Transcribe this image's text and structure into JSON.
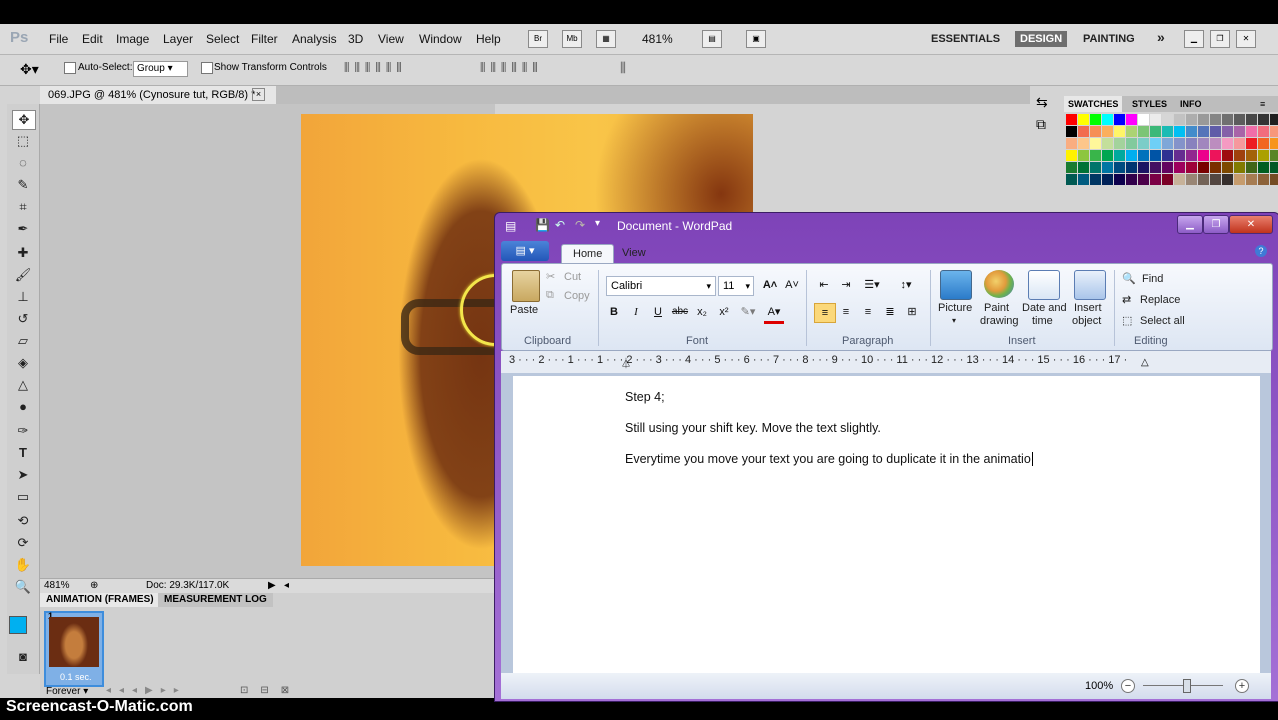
{
  "photoshop": {
    "logo": "Ps",
    "menu": [
      "File",
      "Edit",
      "Image",
      "Layer",
      "Select",
      "Filter",
      "Analysis",
      "3D",
      "View",
      "Window",
      "Help"
    ],
    "appbar": {
      "zoom": "481%",
      "br": "Br",
      "mb": "Mb"
    },
    "workspaces": [
      "ESSENTIALS",
      "DESIGN",
      "PAINTING"
    ],
    "workspace_more": "»",
    "options": {
      "auto_select_label": "Auto-Select:",
      "auto_select_value": "Group",
      "transform_label": "Show Transform Controls"
    },
    "doc_tab": {
      "title": "069.JPG @ 481% (Cynosure tut, RGB/8) *",
      "close": "×"
    },
    "status": {
      "zoom": "481%",
      "doc": "Doc: 29.3K/117.0K"
    },
    "anim_tabs": [
      "ANIMATION (FRAMES)",
      "MEASUREMENT LOG"
    ],
    "frame": {
      "number": "1",
      "delay": "0.1 sec."
    },
    "loop": "Forever",
    "swatch_tabs": [
      "SWATCHES",
      "STYLES",
      "INFO"
    ],
    "swatch_colors": [
      "#ff0000",
      "#ffff00",
      "#00ff00",
      "#00ffff",
      "#0000ff",
      "#ff00ff",
      "#ffffff",
      "#ebebeb",
      "#d6d6d6",
      "#c2c2c2",
      "#adadad",
      "#999999",
      "#858585",
      "#707070",
      "#5c5c5c",
      "#474747",
      "#333333",
      "#1f1f1f",
      "#000000",
      "#f26c4f",
      "#f68e56",
      "#fbaf5d",
      "#fff568",
      "#acd373",
      "#7cc576",
      "#3bb878",
      "#1abbb4",
      "#00bff3",
      "#438ccb",
      "#5574b9",
      "#605ca8",
      "#8560a8",
      "#a864a8",
      "#f06ea9",
      "#f26d7d",
      "#f7977a",
      "#f9ad81",
      "#fdc68a",
      "#fff79a",
      "#c4df9b",
      "#a3d39c",
      "#82ca9d",
      "#7bcdc8",
      "#6ecff6",
      "#7ea7d8",
      "#8493ca",
      "#8882be",
      "#a187be",
      "#bc8dbf",
      "#f49ac2",
      "#f6989d",
      "#ed1c24",
      "#f26522",
      "#f7941d",
      "#fff200",
      "#8dc63f",
      "#39b54a",
      "#00a651",
      "#00a99d",
      "#00aeef",
      "#0072bc",
      "#0054a6",
      "#2e3192",
      "#662d91",
      "#92278f",
      "#ec008c",
      "#ed145b",
      "#9e0b0f",
      "#a0410d",
      "#a36209",
      "#aba000",
      "#598527",
      "#1a7b30",
      "#007236",
      "#00746b",
      "#0076a3",
      "#004b80",
      "#003471",
      "#1b1464",
      "#440e62",
      "#630460",
      "#9e005d",
      "#9e0039",
      "#790000",
      "#7b2e00",
      "#7d4900",
      "#827b00",
      "#406618",
      "#005e20",
      "#005826",
      "#005952",
      "#005b7f",
      "#003663",
      "#002157",
      "#0d004c",
      "#32004b",
      "#4b0049",
      "#7b0046",
      "#7a0026",
      "#c7b299",
      "#998675",
      "#736357",
      "#534741",
      "#362f2d",
      "#c69c6d",
      "#a67c52",
      "#8c6239",
      "#754c24"
    ],
    "watermark": "Screencast-O-Matic.com"
  },
  "wordpad": {
    "title": "Document - WordPad",
    "tabs": [
      "Home",
      "View"
    ],
    "clipboard": {
      "paste": "Paste",
      "cut": "Cut",
      "copy": "Copy",
      "label": "Clipboard"
    },
    "font": {
      "name": "Calibri",
      "size": "11",
      "label": "Font"
    },
    "paragraph_label": "Paragraph",
    "insert": {
      "picture": "Picture",
      "paint": "Paint",
      "paint2": "drawing",
      "date": "Date and",
      "date2": "time",
      "object": "Insert",
      "object2": "object",
      "label": "Insert"
    },
    "editing": {
      "find": "Find",
      "replace": "Replace",
      "select_all": "Select all",
      "label": "Editing"
    },
    "ruler": "3 · · · 2 · · · 1 · · · 1 · · · 2 · · · 3 · · · 4 · · · 5 · · · 6 · · · 7 · · · 8 · · · 9 · · · 10 · · · 11 · · · 12 · · · 13 · · · 14 · · · 15 · · · 16 · · · 17 ·",
    "document": {
      "line1": "Step 4;",
      "line2": "Still using your shift key. Move the text slightly.",
      "line3": "Everytime you move your text you are going to duplicate it in the animatio"
    },
    "zoom": "100%"
  }
}
